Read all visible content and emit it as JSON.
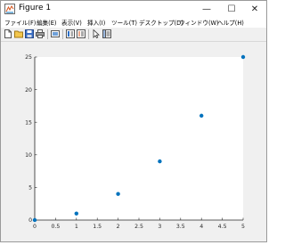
{
  "window": {
    "title": "Figure 1",
    "controls": {
      "minimize": "—",
      "maximize": "☐",
      "close": "✕"
    }
  },
  "menu": {
    "items": [
      {
        "label": "ファイル(F)"
      },
      {
        "label": "編集(E)"
      },
      {
        "label": "表示(V)"
      },
      {
        "label": "挿入(I)"
      },
      {
        "label": "ツール(T)"
      },
      {
        "label": "デスクトップ(D)"
      },
      {
        "label": "ウィンドウ(W)"
      },
      {
        "label": "ヘルプ(H)"
      }
    ]
  },
  "toolbar": {
    "icons": [
      "new-figure-icon",
      "open-file-icon",
      "save-icon",
      "print-icon",
      "link-plot-icon",
      "insert-colorbar-icon",
      "edit-plot-icon",
      "property-editor-icon"
    ]
  },
  "colors": {
    "marker": "#0072bd",
    "axes_background": "#ffffff",
    "figure_background": "#f0f0f0"
  },
  "chart_data": {
    "type": "scatter",
    "x": [
      0,
      1,
      2,
      3,
      4,
      5
    ],
    "y": [
      0,
      1,
      4,
      9,
      16,
      25
    ],
    "xlim": [
      0,
      5
    ],
    "ylim": [
      0,
      25
    ],
    "xticks": [
      "0",
      "0.5",
      "1",
      "1.5",
      "2",
      "2.5",
      "3",
      "3.5",
      "4",
      "4.5",
      "5"
    ],
    "yticks": [
      "0",
      "5",
      "10",
      "15",
      "20",
      "25"
    ],
    "xtick_values": [
      0,
      0.5,
      1,
      1.5,
      2,
      2.5,
      3,
      3.5,
      4,
      4.5,
      5
    ],
    "ytick_values": [
      0,
      5,
      10,
      15,
      20,
      25
    ],
    "grid": false,
    "title": "",
    "xlabel": "",
    "ylabel": ""
  }
}
